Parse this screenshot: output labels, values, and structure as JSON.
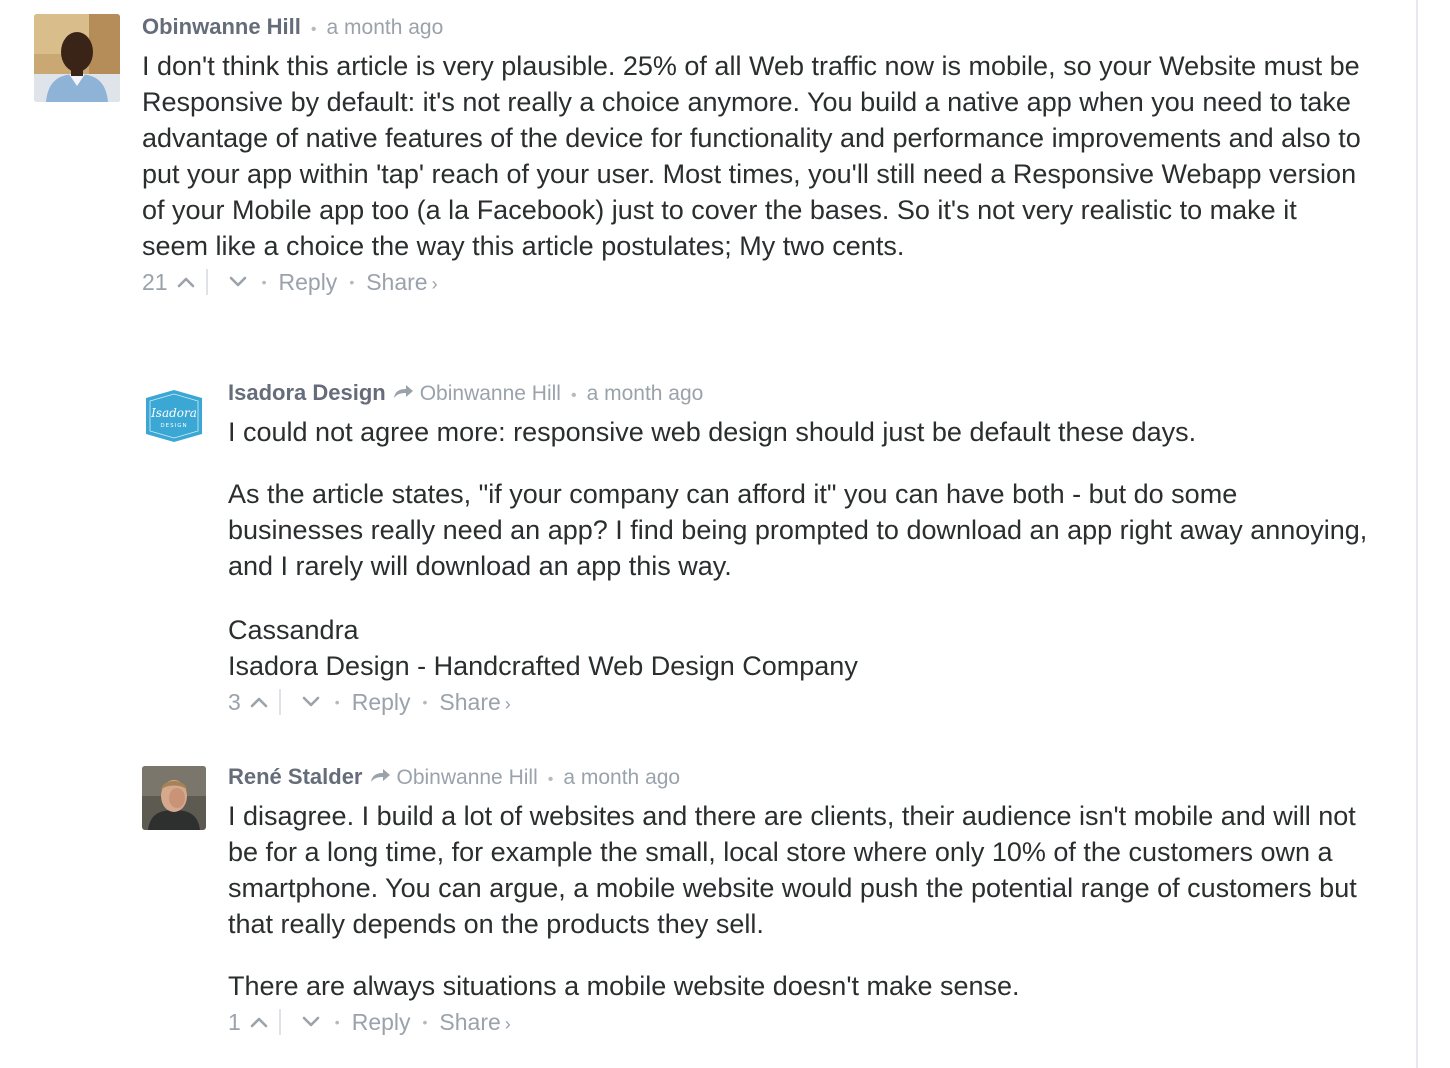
{
  "comments": [
    {
      "author": "Obinwanne Hill",
      "parent_author": "",
      "time": "a month ago",
      "paragraphs": [
        "I don't think this article is very plausible. 25% of all Web traffic now is mobile, so your Website must be Responsive by default: it's not really a choice anymore. You build a native app when you need to take advantage of native features of the device for functionality and performance improvements and also to put your app within 'tap' reach of your user. Most times, you'll still need a Responsive Webapp version of your Mobile app too (a la Facebook) just to cover the bases. So it's not very realistic to make it seem like a choice the way this article postulates; My two cents."
      ],
      "votes": "21",
      "reply_label": "Reply",
      "share_label": "Share",
      "avatar_icon": "person-photo-avatar"
    },
    {
      "author": "Isadora Design",
      "parent_author": "Obinwanne Hill",
      "time": "a month ago",
      "paragraphs": [
        "I could not agree more: responsive web design should just be default these days.",
        "As the article states, \"if your company can afford it\" you can have both - but do some businesses really need an app? I find being prompted to download an app right away annoying, and I rarely will download an app this way.",
        "Cassandra",
        "Isadora Design - Handcrafted Web Design Company"
      ],
      "votes": "3",
      "reply_label": "Reply",
      "share_label": "Share",
      "avatar_icon": "isadora-logo-avatar",
      "avatar_text": "Isadora",
      "avatar_subtext": "DESIGN"
    },
    {
      "author": "René Stalder",
      "parent_author": "Obinwanne Hill",
      "time": "a month ago",
      "paragraphs": [
        "I disagree. I build a lot of websites and there are clients, their audience isn't mobile and will not be for a long time, for example the small, local store where only 10% of the customers own a smartphone. You can argue, a mobile website would push the potential range of customers but that really depends on the products they sell.",
        "There are always situations a mobile website doesn't make sense."
      ],
      "votes": "1",
      "reply_label": "Reply",
      "share_label": "Share",
      "avatar_icon": "person-photo-avatar"
    }
  ],
  "colors": {
    "author": "#656c7a",
    "meta": "#9aa2ab",
    "text": "#2a2e2e",
    "isadora_badge": "#3aa7d4"
  }
}
